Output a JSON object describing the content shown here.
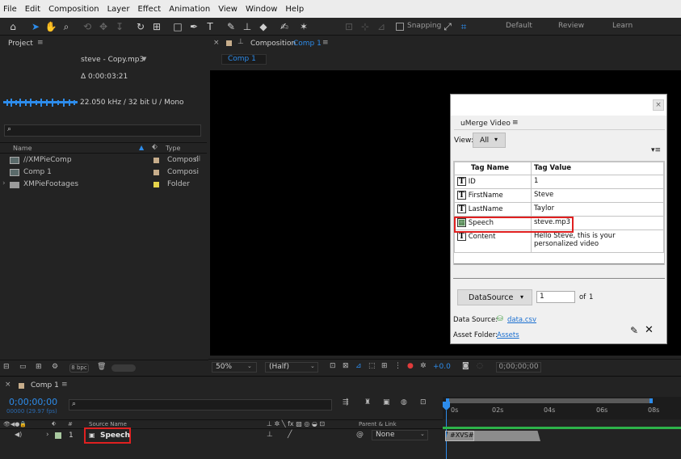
{
  "menu": [
    "File",
    "Edit",
    "Composition",
    "Layer",
    "Effect",
    "Animation",
    "View",
    "Window",
    "Help"
  ],
  "toolbar": {
    "snapping_label": "Snapping",
    "workspaces": [
      "Default",
      "Review",
      "Learn"
    ]
  },
  "project": {
    "title": "Project",
    "file_name": "steve - Copy.mp3",
    "duration": "Δ 0:00:03:21",
    "audio_info": "22.050 kHz / 32 bit U / Mono",
    "search_placeholder": "",
    "col_name": "Name",
    "col_type": "Type",
    "items": [
      {
        "name": "//XMPieComp",
        "type": "Composi",
        "color": "#c7ad8b"
      },
      {
        "name": "Comp 1",
        "type": "Composi",
        "color": "#c7ad8b"
      },
      {
        "name": "XMPieFootages",
        "type": "Folder",
        "color": "#e6d44b"
      }
    ],
    "bpc": "8 bpc"
  },
  "composition": {
    "title_prefix": "Composition",
    "title_name": "Comp 1",
    "tab": "Comp 1",
    "zoom": "50%",
    "resolution": "(Half)",
    "exposure": "+0.0",
    "timecode": "0;00;00;00"
  },
  "umerge": {
    "title": "uMerge Video",
    "view_label": "View:",
    "view_value": "All",
    "col_tag_name": "Tag Name",
    "col_tag_value": "Tag Value",
    "rows": [
      {
        "icon": "T",
        "name": "ID",
        "value": "1"
      },
      {
        "icon": "T",
        "name": "FirstName",
        "value": "Steve"
      },
      {
        "icon": "T",
        "name": "LastName",
        "value": "Taylor"
      },
      {
        "icon": "img",
        "name": "Speech",
        "value": "steve.mp3"
      },
      {
        "icon": "T",
        "name": "Content",
        "value": "Hello Steve, this is your personalized video"
      }
    ],
    "datasource_button": "DataSource",
    "record_value": "1",
    "of_label": "of",
    "record_total": "1",
    "data_source_label": "Data Source:",
    "data_source_link": "data.csv",
    "asset_folder_label": "Asset Folder:",
    "asset_folder_link": "Assets"
  },
  "timeline": {
    "tab": "Comp 1",
    "timecode": "0;00;00;00",
    "fps": "00000 (29.97 fps)",
    "col_source": "Source Name",
    "col_parent": "Parent & Link",
    "layer_num": "1",
    "layer_name": "Speech",
    "parent_value": "None",
    "ruler": [
      "0s",
      "02s",
      "04s",
      "06s",
      "08s"
    ],
    "clip_label": "#XVS#"
  }
}
